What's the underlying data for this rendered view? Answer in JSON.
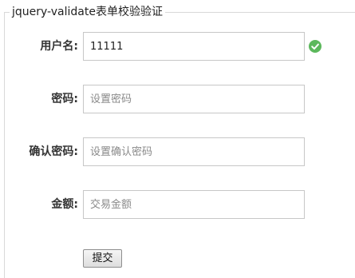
{
  "form": {
    "legend": "jquery-validate表单校验验证",
    "fields": [
      {
        "label": "用户名:",
        "value": "11111",
        "placeholder": "",
        "valid": true
      },
      {
        "label": "密码:",
        "value": "",
        "placeholder": "设置密码"
      },
      {
        "label": "确认密码:",
        "value": "",
        "placeholder": "设置确认密码"
      },
      {
        "label": "金额:",
        "value": "",
        "placeholder": "交易金额"
      }
    ],
    "submit_label": "提交",
    "valid_icon": "check-circle-icon",
    "valid_color": "#5cb85c"
  }
}
